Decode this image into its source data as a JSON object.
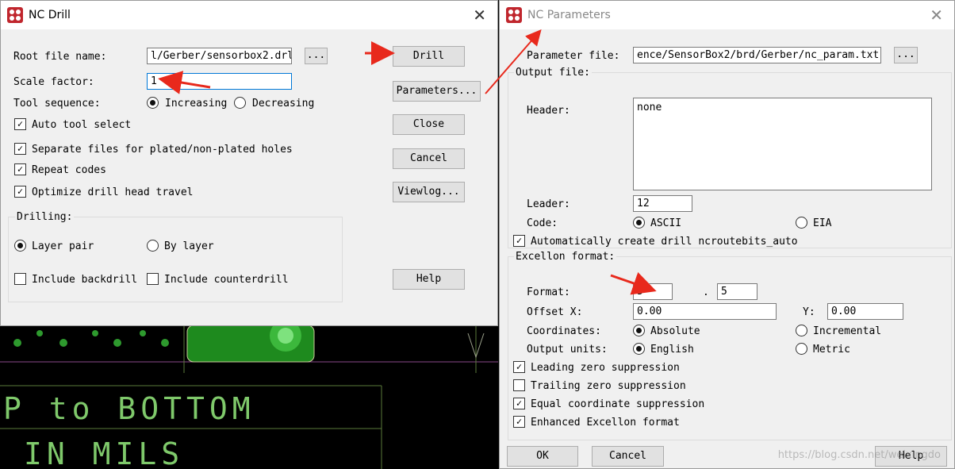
{
  "nc_drill": {
    "title": "NC Drill",
    "root_file_label": "Root file name:",
    "root_file_value": "l/Gerber/sensorbox2.drl",
    "browse_label": "...",
    "scale_label": "Scale factor:",
    "scale_value": "1",
    "tool_seq_label": "Tool sequence:",
    "increasing_label": "Increasing",
    "decreasing_label": "Decreasing",
    "auto_tool_label": "Auto tool select",
    "separate_label": "Separate files for plated/non-plated holes",
    "repeat_label": "Repeat codes",
    "optimize_label": "Optimize drill head travel",
    "drilling_label": "Drilling:",
    "layer_pair_label": "Layer pair",
    "by_layer_label": "By layer",
    "backdrill_label": "Include backdrill",
    "counterdrill_label": "Include counterdrill",
    "buttons": {
      "drill": "Drill",
      "parameters": "Parameters...",
      "close": "Close",
      "cancel": "Cancel",
      "viewlog": "Viewlog...",
      "help": "Help"
    }
  },
  "nc_params": {
    "title": "NC Parameters",
    "param_file_label": "Parameter file:",
    "param_file_value": "ence/SensorBox2/brd/Gerber/nc_param.txt",
    "browse_label": "...",
    "output_file_label": "Output file:",
    "header_label": "Header:",
    "header_value": "none",
    "leader_label": "Leader:",
    "leader_value": "12",
    "code_label": "Code:",
    "ascii_label": "ASCII",
    "eia_label": "EIA",
    "auto_create_label": "Automatically create drill ncroutebits_auto",
    "excellon_label": "Excellon format:",
    "format_label": "Format:",
    "format_int": "5",
    "format_sep": ".",
    "format_dec": "5",
    "offset_x_label": "Offset X:",
    "offset_x_value": "0.00",
    "offset_y_label": "Y:",
    "offset_y_value": "0.00",
    "coords_label": "Coordinates:",
    "absolute_label": "Absolute",
    "incremental_label": "Incremental",
    "units_label": "Output units:",
    "english_label": "English",
    "metric_label": "Metric",
    "leading_label": "Leading zero suppression",
    "trailing_label": "Trailing zero suppression",
    "equal_label": "Equal coordinate suppression",
    "enhanced_label": "Enhanced Excellon format",
    "ok_label": "OK",
    "cancel_label": "Cancel",
    "help_label": "Help"
  },
  "pcb": {
    "line1": "P to BOTTOM",
    "line2": "IN MILS"
  },
  "watermark": "https://blog.csdn.net/weixingdo",
  "colors": {
    "arrow": "#e8291c",
    "pcb_green": "#1e8a1e",
    "pcb_text": "#7fc96b"
  }
}
